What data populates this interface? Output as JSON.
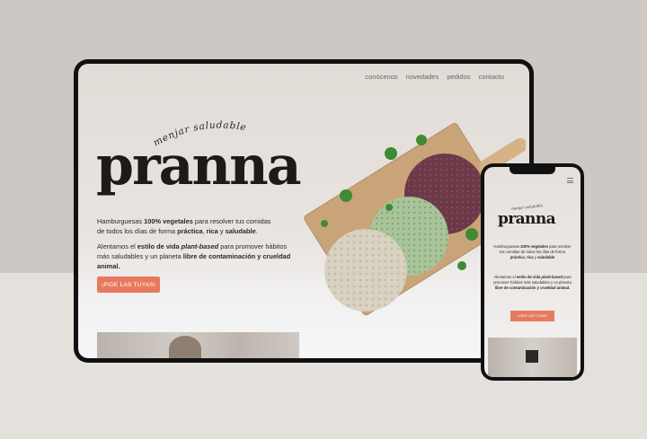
{
  "nav": {
    "items": [
      "conócenos",
      "novedades",
      "pedidos",
      "contacto"
    ]
  },
  "hero": {
    "tagline": "menjar saludable",
    "brand": "pranna",
    "reg_mark": "®",
    "intro_pre": "Hamburguesas ",
    "intro_b1": "100% vegetales",
    "intro_mid": " para resolver tus comidas",
    "intro_line2": "de todos los días de forma ",
    "intro_b2": "práctica",
    "intro_sep": ", ",
    "intro_b3": "rica",
    "intro_and": " y ",
    "intro_b4": "saludable",
    "intro_end": ".",
    "p2_pre": "Alentamos el ",
    "p2_b1": "estilo de vida ",
    "p2_i": "plant-based",
    "p2_mid": " para promover hábitos",
    "p2_line2": "más saludables y un planeta ",
    "p2_b2": "libre de contaminación y crueldad animal.",
    "cta": "¡PIDE LAS TUYAS!"
  },
  "colors": {
    "accent": "#e77a5e",
    "brand_text": "#1d1b1a"
  }
}
